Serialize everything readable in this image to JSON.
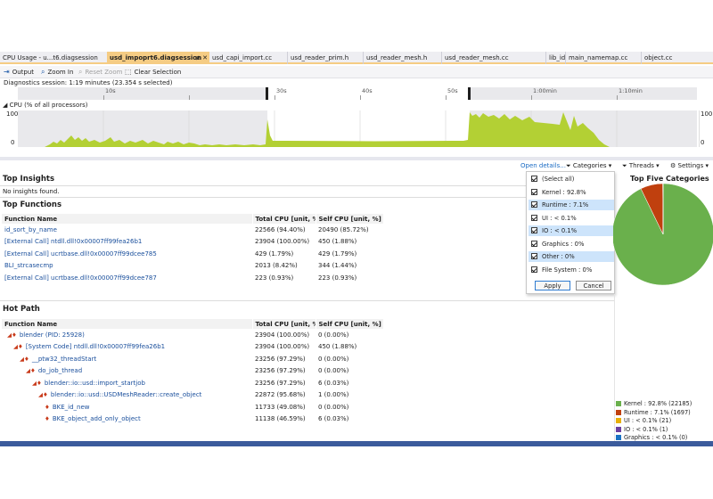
{
  "tabs": [
    {
      "label": "CPU Usage - u...t6.diagsession",
      "active": false
    },
    {
      "label": "usd_impoprt6.diagsession",
      "active": true,
      "extra": "≢ ✕"
    },
    {
      "label": "usd_capi_import.cc",
      "active": false
    },
    {
      "label": "usd_reader_prim.h",
      "active": false
    },
    {
      "label": "usd_reader_mesh.h",
      "active": false
    },
    {
      "label": "usd_reader_mesh.cc",
      "active": false
    },
    {
      "label": "lib_id.c",
      "active": false
    },
    {
      "label": "main_namemap.cc",
      "active": false
    },
    {
      "label": "object.cc",
      "active": false
    }
  ],
  "toolbar": {
    "output": "Output",
    "zoom_in": "Zoom In",
    "reset_zoom": "Reset Zoom",
    "clear_selection": "Clear Selection"
  },
  "session": "Diagnostics session: 1:19 minutes (23.354 s selected)",
  "ruler": {
    "ticks": [
      "10s",
      "30s",
      "40s",
      "50s",
      "1:00min",
      "1:10min"
    ]
  },
  "cpu_graph": {
    "label": "◢ CPU (% of all processors)",
    "y_max": "100",
    "y_min": "0"
  },
  "right_axis": {
    "y_max": "100",
    "y_min": "0"
  },
  "filterbar": {
    "open_details": "Open details...",
    "categories": "Categories",
    "threads": "Threads",
    "settings": "Settings"
  },
  "insights": {
    "title": "Top Insights",
    "empty": "No insights found."
  },
  "top_functions": {
    "title": "Top Functions",
    "headers": [
      "Function Name",
      "Total CPU [unit, %]",
      "Self CPU [unit, %]"
    ],
    "rows": [
      [
        "id_sort_by_name",
        "22566 (94.40%)",
        "20490 (85.72%)"
      ],
      [
        "[External Call] ntdll.dll!0x00007ff99fea26b1",
        "23904 (100.00%)",
        "450 (1.88%)"
      ],
      [
        "[External Call] ucrtbase.dll!0x00007ff99dcee785",
        "429 (1.79%)",
        "429 (1.79%)"
      ],
      [
        "BLI_strcasecmp",
        "2013 (8.42%)",
        "344 (1.44%)"
      ],
      [
        "[External Call] ucrtbase.dll!0x00007ff99dcee787",
        "223 (0.93%)",
        "223 (0.93%)"
      ]
    ]
  },
  "hot_path": {
    "title": "Hot Path",
    "headers": [
      "Function Name",
      "Total CPU [unit, %]",
      "Self CPU [unit, %]"
    ],
    "rows": [
      {
        "name": "blender (PID: 25928)",
        "total": "23904 (100.00%)",
        "self": "0 (0.00%)",
        "indent": 0
      },
      {
        "name": "[System Code] ntdll.dll!0x00007ff99fea26b1",
        "total": "23904 (100.00%)",
        "self": "450 (1.88%)",
        "indent": 1
      },
      {
        "name": "__ptw32_threadStart",
        "total": "23256 (97.29%)",
        "self": "0 (0.00%)",
        "indent": 2
      },
      {
        "name": "do_job_thread",
        "total": "23256 (97.29%)",
        "self": "0 (0.00%)",
        "indent": 3
      },
      {
        "name": "blender::io::usd::import_startjob",
        "total": "23256 (97.29%)",
        "self": "6 (0.03%)",
        "indent": 4
      },
      {
        "name": "blender::io::usd::USDMeshReader::create_object",
        "total": "22872 (95.68%)",
        "self": "1 (0.00%)",
        "indent": 5
      },
      {
        "name": "BKE_id_new",
        "total": "11733 (49.08%)",
        "self": "0 (0.00%)",
        "indent": 6
      },
      {
        "name": "BKE_object_add_only_object",
        "total": "11138 (46.59%)",
        "self": "6 (0.03%)",
        "indent": 6
      }
    ]
  },
  "categories_dropdown": {
    "items": [
      {
        "label": "(Select all)",
        "highlight": false
      },
      {
        "label": "Kernel : 92.8%",
        "highlight": false
      },
      {
        "label": "Runtime : 7.1%",
        "highlight": true
      },
      {
        "label": "UI : < 0.1%",
        "highlight": false
      },
      {
        "label": "IO : < 0.1%",
        "highlight": true
      },
      {
        "label": "Graphics : 0%",
        "highlight": false
      },
      {
        "label": "Other : 0%",
        "highlight": true
      },
      {
        "label": "File System : 0%",
        "highlight": false
      }
    ],
    "apply": "Apply",
    "cancel": "Cancel"
  },
  "pie": {
    "title": "Top Five Categories",
    "legend": [
      {
        "label": "Kernel : 92.8% (22185)",
        "color": "#6ab04c"
      },
      {
        "label": "Runtime : 7.1% (1697)",
        "color": "#c0400e"
      },
      {
        "label": "UI : < 0.1% (21)",
        "color": "#e8b007"
      },
      {
        "label": "IO : < 0.1% (1)",
        "color": "#6b3fa0"
      },
      {
        "label": "Graphics : < 0.1% (0)",
        "color": "#1a73c4"
      }
    ],
    "slices": [
      92.8,
      7.1,
      0.05,
      0.03,
      0.02
    ]
  },
  "colors": {
    "accent_tab": "#f5cc84",
    "graph_fill": "#b3d034",
    "link": "#1a6bc4"
  }
}
